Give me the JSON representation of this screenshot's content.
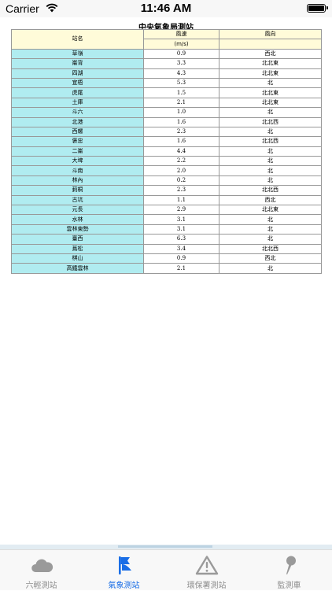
{
  "status_bar": {
    "carrier": "Carrier",
    "time": "11:46 AM"
  },
  "title": "中央氣象局測站",
  "table": {
    "col_station": "站名",
    "col_speed": "風速",
    "col_speed_unit": "(m/s)",
    "col_direction": "風向",
    "rows": [
      {
        "station": "草嶺",
        "speed": "0.9",
        "direction": "西北"
      },
      {
        "station": "崙背",
        "speed": "3.3",
        "direction": "北北東"
      },
      {
        "station": "四湖",
        "speed": "4.3",
        "direction": "北北東"
      },
      {
        "station": "宜梧",
        "speed": "5.3",
        "direction": "北"
      },
      {
        "station": "虎尾",
        "speed": "1.5",
        "direction": "北北東"
      },
      {
        "station": "土庫",
        "speed": "2.1",
        "direction": "北北東"
      },
      {
        "station": "斗六",
        "speed": "1.0",
        "direction": "北"
      },
      {
        "station": "北港",
        "speed": "1.6",
        "direction": "北北西"
      },
      {
        "station": "西螺",
        "speed": "2.3",
        "direction": "北"
      },
      {
        "station": "褒忠",
        "speed": "1.6",
        "direction": "北北西"
      },
      {
        "station": "二崙",
        "speed": "4.4",
        "direction": "北"
      },
      {
        "station": "大埤",
        "speed": "2.2",
        "direction": "北"
      },
      {
        "station": "斗南",
        "speed": "2.0",
        "direction": "北"
      },
      {
        "station": "林內",
        "speed": "0.2",
        "direction": "北"
      },
      {
        "station": "莿桐",
        "speed": "2.3",
        "direction": "北北西"
      },
      {
        "station": "古坑",
        "speed": "1.1",
        "direction": "西北"
      },
      {
        "station": "元長",
        "speed": "2.9",
        "direction": "北北東"
      },
      {
        "station": "水林",
        "speed": "3.1",
        "direction": "北"
      },
      {
        "station": "雲林東勢",
        "speed": "3.1",
        "direction": "北"
      },
      {
        "station": "臺西",
        "speed": "6.3",
        "direction": "北"
      },
      {
        "station": "蔦松",
        "speed": "3.4",
        "direction": "北北西"
      },
      {
        "station": "棋山",
        "speed": "0.9",
        "direction": "西北"
      },
      {
        "station": "高鐵雲林",
        "speed": "2.1",
        "direction": "北"
      }
    ]
  },
  "tabs": [
    {
      "label": "六輕測站",
      "icon": "cloud-icon",
      "active": false
    },
    {
      "label": "氣象測站",
      "icon": "flag-icon",
      "active": true
    },
    {
      "label": "環保署測站",
      "icon": "warning-icon",
      "active": false
    },
    {
      "label": "監測車",
      "icon": "map-pin-icon",
      "active": false
    }
  ],
  "colors": {
    "accent": "#1a6ee6",
    "station_cell": "#b0ecf0",
    "header_cell": "#fffbd9",
    "tab_inactive": "#8e8e8e"
  }
}
